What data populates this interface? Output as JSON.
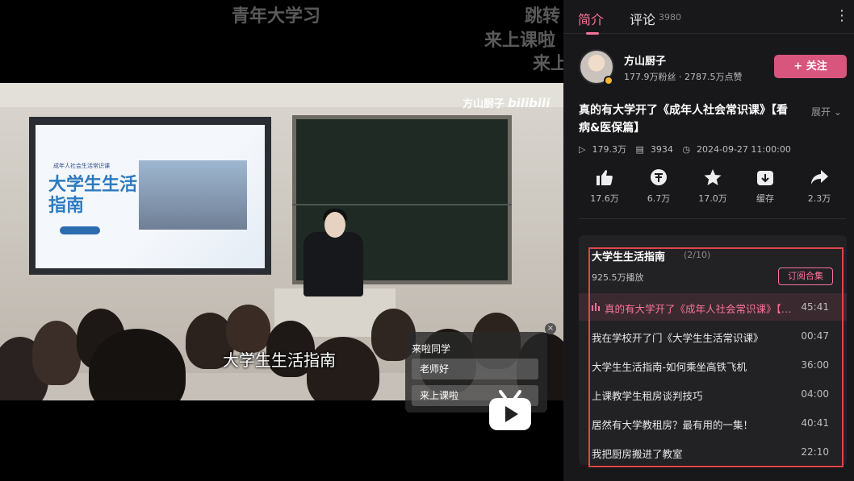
{
  "danmaku": [
    "青年大学习",
    "跳转",
    "来上课啦",
    "来上"
  ],
  "video": {
    "watermark_name": "方山厨子",
    "watermark_logo": "bilibili",
    "subtitle": "大学生生活指南",
    "slide": {
      "small": "成年人社会生活常识课",
      "title": "大学生生活指南"
    },
    "vote": {
      "title": "来啦同学",
      "options": [
        "老师好",
        "来上课啦"
      ],
      "close": "×"
    }
  },
  "panel": {
    "tabs": {
      "intro": "简介",
      "comments": "评论",
      "comment_count": "3980",
      "more": "⋮"
    },
    "uploader": {
      "name": "方山厨子",
      "stats": "177.9万粉丝 · 2787.5万点赞",
      "follow_label": "+ 关注"
    },
    "title": "真的有大学开了《成年人社会常识课》【看病&医保篇】",
    "expand": "展开",
    "meta": {
      "views": "179.3万",
      "danmaku": "3934",
      "date": "2024-09-27 11:00:00"
    },
    "actions": [
      {
        "icon": "thumbs-up-icon",
        "count": "17.6万"
      },
      {
        "icon": "coin-icon",
        "count": "6.7万"
      },
      {
        "icon": "star-icon",
        "count": "17.0万"
      },
      {
        "icon": "download-icon",
        "count": "缓存"
      },
      {
        "icon": "share-icon",
        "count": "2.3万"
      }
    ],
    "collection": {
      "title": "大学生生活指南",
      "progress": "(2/10)",
      "plays": "925.5万播放",
      "subscribe_label": "订阅合集",
      "episodes": [
        {
          "title": "真的有大学开了《成年人社会常识课》【看病&医保篇】",
          "duration": "45:41",
          "active": true
        },
        {
          "title": "我在学校开了门《大学生生活常识课》",
          "duration": "00:47"
        },
        {
          "title": "大学生生活指南-如何乘坐高铁飞机",
          "duration": "36:00"
        },
        {
          "title": "上课教学生租房谈判技巧",
          "duration": "04:00"
        },
        {
          "title": "居然有大学教租房？最有用的一集！",
          "duration": "40:41"
        },
        {
          "title": "我把厨房搬进了教室",
          "duration": "22:10"
        }
      ]
    }
  },
  "colors": {
    "accent": "#fb7299",
    "follow": "#d8557d",
    "highlight": "#e4444b",
    "panel_bg": "#18181a"
  }
}
